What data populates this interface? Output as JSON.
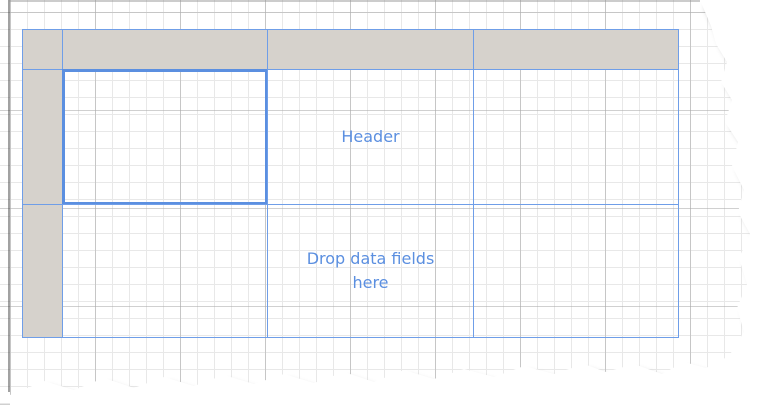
{
  "tablix": {
    "header_cell": "Header",
    "data_cell": "Drop data fields\nhere"
  }
}
